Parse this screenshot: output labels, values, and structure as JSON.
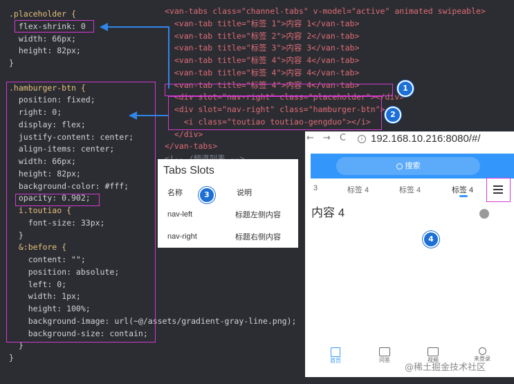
{
  "code_left": {
    "lines": [
      {
        "text": ".placeholder {",
        "kind": "sel"
      },
      {
        "text": "  flex-shrink: 0",
        "kind": "prop"
      },
      {
        "text": "  width: 66px;",
        "kind": "prop"
      },
      {
        "text": "  height: 82px;",
        "kind": "prop"
      },
      {
        "text": "}",
        "kind": "brace"
      },
      {
        "text": "",
        "kind": "brace"
      },
      {
        "text": ".hamburger-btn {",
        "kind": "sel"
      },
      {
        "text": "  position: fixed;",
        "kind": "prop"
      },
      {
        "text": "  right: 0;",
        "kind": "prop"
      },
      {
        "text": "  display: flex;",
        "kind": "prop"
      },
      {
        "text": "  justify-content: center;",
        "kind": "prop"
      },
      {
        "text": "  align-items: center;",
        "kind": "prop"
      },
      {
        "text": "  width: 66px;",
        "kind": "prop"
      },
      {
        "text": "  height: 82px;",
        "kind": "prop"
      },
      {
        "text": "  background-color: #fff;",
        "kind": "prop"
      },
      {
        "text": "  opacity: 0.902;",
        "kind": "prop"
      },
      {
        "text": "  i.toutiao {",
        "kind": "sel"
      },
      {
        "text": "    font-size: 33px;",
        "kind": "prop"
      },
      {
        "text": "  }",
        "kind": "brace"
      },
      {
        "text": "  &:before {",
        "kind": "sel"
      },
      {
        "text": "    content: \"\";",
        "kind": "prop"
      },
      {
        "text": "    position: absolute;",
        "kind": "prop"
      },
      {
        "text": "    left: 0;",
        "kind": "prop"
      },
      {
        "text": "    width: 1px;",
        "kind": "prop"
      },
      {
        "text": "    height: 100%;",
        "kind": "prop"
      },
      {
        "text": "    background-image: url(~@/assets/gradient-gray-line.png);",
        "kind": "prop"
      },
      {
        "text": "    background-size: contain;",
        "kind": "prop"
      },
      {
        "text": "  }",
        "kind": "brace"
      },
      {
        "text": "}",
        "kind": "brace"
      }
    ]
  },
  "code_right": {
    "lines": [
      {
        "text": "<van-tabs class=\"channel-tabs\" v-model=\"active\" animated swipeable>",
        "kind": "tag"
      },
      {
        "text": "  <van-tab title=\"标签 1\">内容 1</van-tab>",
        "kind": "tag"
      },
      {
        "text": "  <van-tab title=\"标签 2\">内容 2</van-tab>",
        "kind": "tag"
      },
      {
        "text": "  <van-tab title=\"标签 3\">内容 3</van-tab>",
        "kind": "tag"
      },
      {
        "text": "  <van-tab title=\"标签 4\">内容 4</van-tab>",
        "kind": "tag"
      },
      {
        "text": "  <van-tab title=\"标签 4\">内容 4</van-tab>",
        "kind": "tag"
      },
      {
        "text": "  <van-tab title=\"标签 4\">内容 4</van-tab>",
        "kind": "tag"
      },
      {
        "text": "  <div slot=\"nav-right\" class=\"placeholder\"></div>",
        "kind": "tag"
      },
      {
        "text": "  <div slot=\"nav-right\" class=\"hamburger-btn\">",
        "kind": "tag"
      },
      {
        "text": "    <i class=\"toutiao toutiao-gengduo\"></i>",
        "kind": "tag"
      },
      {
        "text": "  </div>",
        "kind": "tag"
      },
      {
        "text": "</van-tabs>",
        "kind": "tag"
      },
      {
        "text": "<!-- /频道列表 -->",
        "kind": "cmt"
      }
    ]
  },
  "badges": [
    "1",
    "2",
    "3",
    "4"
  ],
  "slots_table": {
    "title": "Tabs Slots",
    "headers": [
      "名称",
      "说明"
    ],
    "rows": [
      [
        "nav-left",
        "标题左侧内容"
      ],
      [
        "nav-right",
        "标题右侧内容"
      ]
    ]
  },
  "browser": {
    "back": "←",
    "forward": "→",
    "reload": "C",
    "info_icon": "info-icon",
    "url": "192.168.10.216:8080/#/"
  },
  "app": {
    "search_label": "搜索",
    "tabs": [
      "3",
      "标签 4",
      "标签 4",
      "标签 4"
    ],
    "hamburger_icon": "menu-icon",
    "content": "内容 4",
    "tabbar": [
      "首页",
      "问答",
      "视频",
      "未登录"
    ],
    "accent": "#3296fa"
  },
  "watermark": "@稀土掘金技术社区"
}
